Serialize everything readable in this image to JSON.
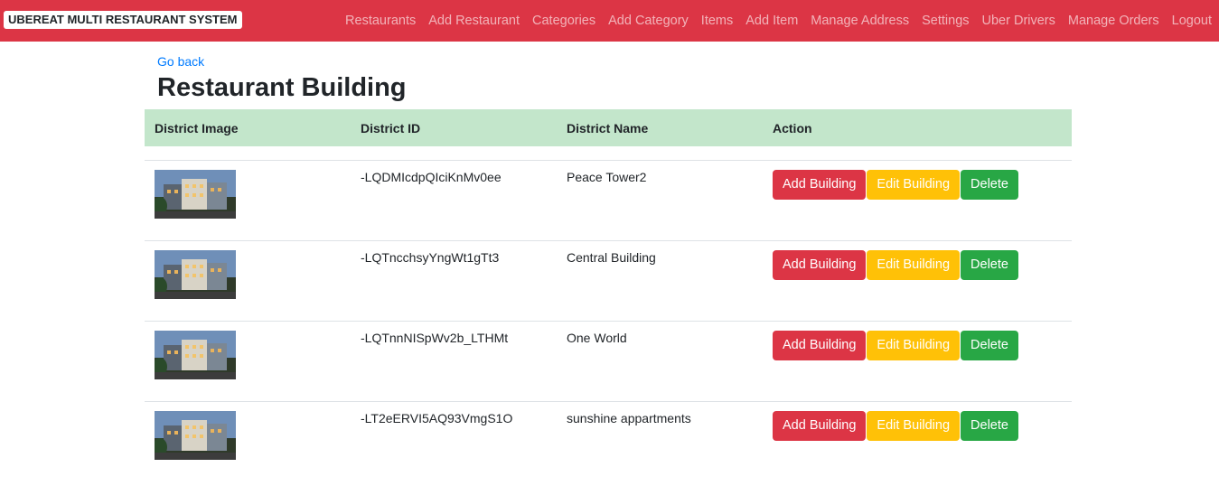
{
  "navbar": {
    "brand": "UBEREAT MULTI RESTAURANT SYSTEM",
    "links": [
      "Restaurants",
      "Add Restaurant",
      "Categories",
      "Add Category",
      "Items",
      "Add Item",
      "Manage Address",
      "Settings",
      "Uber Drivers",
      "Manage Orders",
      "Logout"
    ]
  },
  "go_back": "Go back",
  "title": "Restaurant Building",
  "table": {
    "headers": [
      "District Image",
      "District ID",
      "District Name",
      "Action"
    ],
    "rows": [
      {
        "id": "-LQDMIcdpQIciKnMv0ee",
        "name": "Peace Tower2"
      },
      {
        "id": "-LQTncchsyYngWt1gTt3",
        "name": "Central Building"
      },
      {
        "id": "-LQTnnNISpWv2b_LTHMt",
        "name": "One World"
      },
      {
        "id": "-LT2eERVI5AQ93VmgS1O",
        "name": "sunshine appartments"
      }
    ],
    "actions": {
      "add": "Add Building",
      "edit": "Edit Building",
      "delete": "Delete"
    }
  },
  "colors": {
    "navbar": "#dc3545",
    "header_row": "#c3e6cb",
    "danger": "#dc3545",
    "warning": "#ffc107",
    "success": "#28a745",
    "link": "#007bff"
  }
}
